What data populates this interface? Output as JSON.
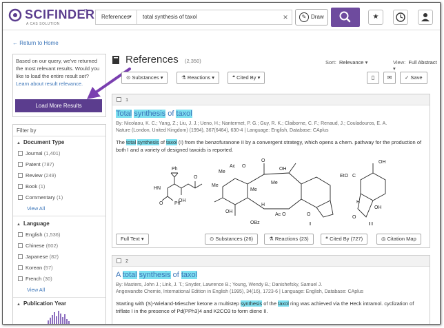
{
  "header": {
    "logo_text": "SCIFINDER",
    "logo_sup": "n",
    "logo_sub": "A CAS SOLUTION",
    "search_type": "References",
    "search_value": "total synthesis of taxol",
    "draw_label": "Draw"
  },
  "left": {
    "back_link": "Return to Home",
    "notice_text": "Based on our query, we've returned the most relevant results. Would you like to load the entire result set?",
    "notice_link": "Learn about result relevance.",
    "load_button": "Load More Results",
    "filter_by": "Filter by",
    "doc_type_title": "Document Type",
    "doc_types": [
      {
        "label": "Journal",
        "count": "(1,401)"
      },
      {
        "label": "Patent",
        "count": "(787)"
      },
      {
        "label": "Review",
        "count": "(249)"
      },
      {
        "label": "Book",
        "count": "(1)"
      },
      {
        "label": "Commentary",
        "count": "(1)"
      }
    ],
    "view_all_1": "View All",
    "language_title": "Language",
    "languages": [
      {
        "label": "English",
        "count": "(1,536)"
      },
      {
        "label": "Chinese",
        "count": "(602)"
      },
      {
        "label": "Japanese",
        "count": "(82)"
      },
      {
        "label": "Korean",
        "count": "(57)"
      },
      {
        "label": "French",
        "count": "(30)"
      }
    ],
    "view_all_2": "View All",
    "pub_year_title": "Publication Year"
  },
  "main": {
    "title": "References",
    "count": "(2,350)",
    "sort_label": "Sort:",
    "sort_value": "Relevance",
    "view_label": "View:",
    "view_value": "Full Abstract",
    "toolbar": {
      "substances": "Substances",
      "reactions": "Reactions",
      "cited_by": "Cited By",
      "save": "Save"
    },
    "results": [
      {
        "index": "1",
        "title_parts": [
          "Total",
          " ",
          "synthesis",
          " of ",
          "taxol"
        ],
        "authors": "By: Nicolaou, K. C.; Yang, Z.; Liu, J. J.; Ueno, H.; Nantermet, P. G.; Guy, R. K.; Claiborne, C. F.; Renaud, J.; Couladouros, E. A.",
        "source": "Nature (London, United Kingdom) (1994), 367(6464), 630-4 | Language: English, Database: CAplus",
        "abstract_pre": "The ",
        "abstract_h1": "total",
        "abstract_h2": "synthesis",
        "abstract_mid": " of ",
        "abstract_h3": "taxol",
        "abstract_post": " (I) from the benzofuranone II by a convergent strategy, which opens a chem. pathway for the production of both I and a variety of designed taxoids is reported.",
        "full_text": "Full Text",
        "substances": "Substances (26)",
        "reactions": "Reactions (23)",
        "cited_by": "Cited By (727)",
        "citation_map": "Citation Map"
      },
      {
        "index": "2",
        "title_parts": [
          "A ",
          "total",
          " ",
          "synthesis",
          " of ",
          "taxol"
        ],
        "authors": "By: Masters, John J.; Link, J. T.; Snyder, Lawrence B.; Young, Wendy B.; Danishefsky, Samuel J.",
        "source": "Angewandte Chemie, International Edition in English (1995), 34(16), 1723-6 | Language: English, Database: CAplus",
        "abstract_pre": "Starting with (S)-Wieland-Miescher ketone a multistep ",
        "abstract_h1": "synthesis",
        "abstract_mid": " of the ",
        "abstract_h2": "taxol",
        "abstract_post": " ring was achieved via the Heck intramol. cyclization of triflate I in the presence of Pd(PPh3)4 and K2CO3 to form diene II."
      }
    ],
    "structure_labels": {
      "me1": "Me",
      "me2": "Me",
      "me3": "Me",
      "me4": "Me",
      "ac": "Ac",
      "o": "O",
      "oh": "OH",
      "ph": "Ph",
      "hn": "HN",
      "obz": "OBz",
      "aco": "Ac O",
      "h": "H",
      "i": "I",
      "eto": "EtO",
      "c": "C",
      "ii": "I I"
    }
  }
}
